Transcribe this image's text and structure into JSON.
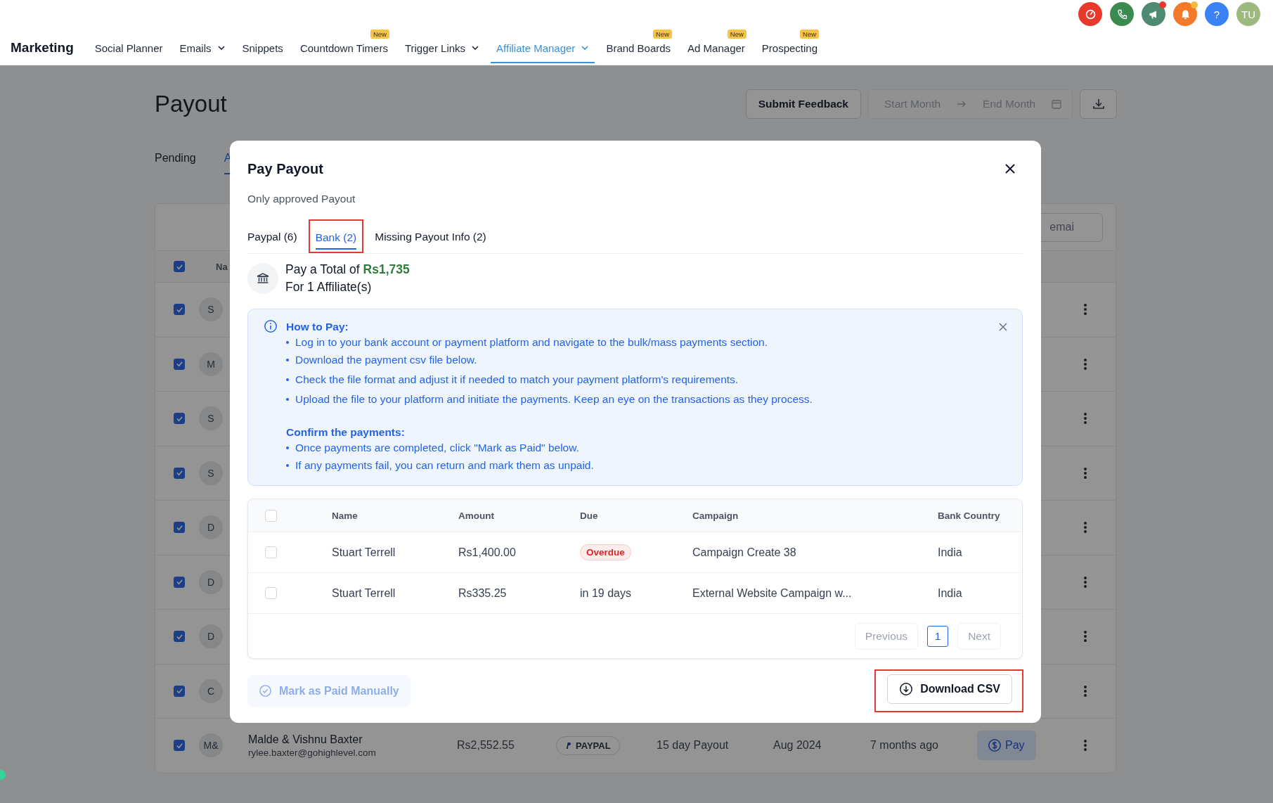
{
  "top_icons": [
    {
      "kind": "speed",
      "color": "#e8392c"
    },
    {
      "kind": "phone",
      "color": "#3b8a50"
    },
    {
      "kind": "megaphone",
      "color": "#4f8a72",
      "dot": {
        "color": "#e53935"
      }
    },
    {
      "kind": "bell",
      "color": "#f27a2a",
      "dot": {
        "color": "#f6b73c"
      }
    },
    {
      "kind": "help",
      "color": "#3b82f6",
      "text": "?"
    },
    {
      "kind": "avatar",
      "color": "#9db97e",
      "text": "TU"
    }
  ],
  "nav": {
    "title": "Marketing",
    "items": [
      {
        "label": "Social Planner",
        "dropdown": false,
        "selected": false
      },
      {
        "label": "Emails",
        "dropdown": true,
        "selected": false
      },
      {
        "label": "Snippets",
        "dropdown": false,
        "selected": false
      },
      {
        "label": "Countdown Timers",
        "dropdown": false,
        "selected": false,
        "badge": "New"
      },
      {
        "label": "Trigger Links",
        "dropdown": true,
        "selected": false
      },
      {
        "label": "Affiliate Manager",
        "dropdown": true,
        "selected": true
      },
      {
        "label": "Brand Boards",
        "dropdown": false,
        "selected": false,
        "badge": "New"
      },
      {
        "label": "Ad Manager",
        "dropdown": false,
        "selected": false,
        "badge": "New"
      },
      {
        "label": "Prospecting",
        "dropdown": false,
        "selected": false,
        "badge": "New"
      }
    ]
  },
  "page": {
    "title": "Payout",
    "feedback_button": "Submit Feedback",
    "date_range": {
      "start": "Start Month",
      "end": "End Month"
    },
    "tabs": [
      {
        "label": "Pending",
        "selected": false
      },
      {
        "label": "A",
        "selected": true
      }
    ],
    "search": {
      "placeholder": "emai"
    },
    "table": {
      "header_checked": true,
      "header_partial": "Na",
      "rows": [
        {
          "initials": "S",
          "checked": true
        },
        {
          "initials": "M",
          "checked": true
        },
        {
          "initials": "S",
          "checked": true
        },
        {
          "initials": "S",
          "checked": true
        },
        {
          "initials": "D",
          "checked": true
        },
        {
          "initials": "D",
          "checked": true
        },
        {
          "initials": "D",
          "checked": true
        },
        {
          "initials": "C",
          "checked": true
        },
        {
          "initials": "M&",
          "checked": true,
          "name": "Malde & Vishnu Baxter",
          "email": "rylee.baxter@gohighlevel.com",
          "amount": "Rs2,552.55",
          "method": "PAYPAL",
          "schedule": "15 day Payout",
          "month": "Aug 2024",
          "age": "7 months ago",
          "action": "Pay"
        }
      ]
    }
  },
  "modal": {
    "title": "Pay Payout",
    "subtitle": "Only approved Payout",
    "tabs": [
      {
        "label": "Paypal (6)",
        "selected": false,
        "highlighted": false
      },
      {
        "label": "Bank (2)",
        "selected": true,
        "highlighted": true
      },
      {
        "label": "Missing Payout Info (2)",
        "selected": false,
        "highlighted": false
      }
    ],
    "summary": {
      "prefix": "Pay a Total of",
      "total": "Rs1,735",
      "count": "For 1 Affiliate(s)"
    },
    "info": {
      "sections": [
        {
          "heading": "How to Pay:",
          "items": [
            "Log in to your bank account or payment platform and navigate to the bulk/mass payments section.",
            "Download the payment csv file below.",
            "Check the file format and adjust it if needed to match your payment platform's requirements.",
            "Upload the file to your platform and initiate the payments. Keep an eye on the transactions as they process."
          ]
        },
        {
          "heading": "Confirm the payments:",
          "items": [
            "Once payments are completed, click \"Mark as Paid\" below.",
            "If any payments fail, you can return and mark them as unpaid."
          ]
        }
      ]
    },
    "table": {
      "header_checked": false,
      "columns": [
        "Name",
        "Amount",
        "Due",
        "Campaign",
        "Bank Country"
      ],
      "rows": [
        {
          "checked": false,
          "name": "Stuart Terrell",
          "amount": "Rs1,400.00",
          "due": "Overdue",
          "overdue": true,
          "campaign": "Campaign Create 38",
          "country": "India"
        },
        {
          "checked": false,
          "name": "Stuart Terrell",
          "amount": "Rs335.25",
          "due": "in 19 days",
          "overdue": false,
          "campaign": "External Website Campaign w...",
          "country": "India"
        }
      ]
    },
    "pagination": {
      "previous": "Previous",
      "page": "1",
      "next": "Next"
    },
    "mark_paid": {
      "label": "Mark as Paid Manually",
      "disabled": true
    },
    "download": {
      "label": "Download CSV",
      "highlighted": true
    }
  }
}
